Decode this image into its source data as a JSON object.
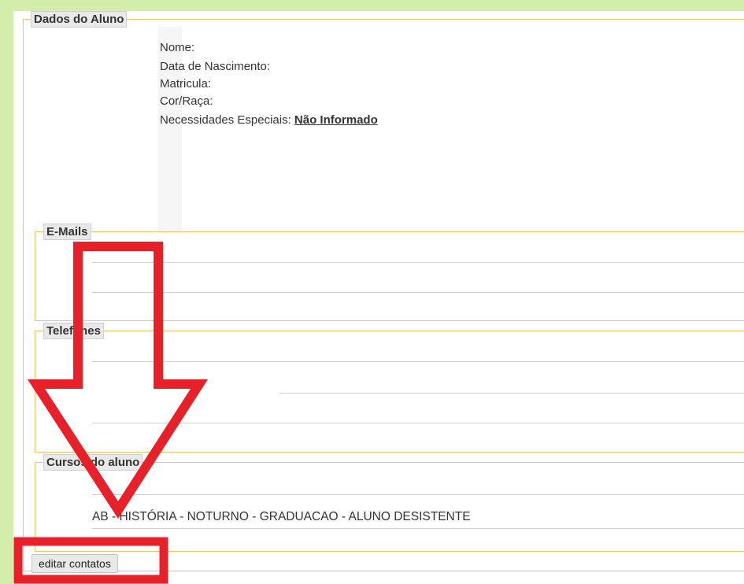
{
  "dados_aluno": {
    "legend": "Dados do Aluno",
    "nome_label": "Nome:",
    "nascimento_label": "Data de Nascimento:",
    "matricula_label": "Matricula:",
    "cor_raca_label": "Cor/Raça:",
    "necessidades_label": "Necessidades Especiais: ",
    "necessidades_value": "Não Informado"
  },
  "emails": {
    "legend": "E-Mails"
  },
  "telefones": {
    "legend": "Telefones"
  },
  "cursos": {
    "legend": "Cursos do aluno",
    "items": [
      "AB - HISTÓRIA - NOTURNO - GRADUACAO - ALUNO DESISTENTE"
    ]
  },
  "actions": {
    "edit_contacts_label": "editar contatos"
  },
  "colors": {
    "page_background": "#d3eeaa",
    "fieldset_border": "#f5c067",
    "annotation_red": "#e8202a"
  }
}
